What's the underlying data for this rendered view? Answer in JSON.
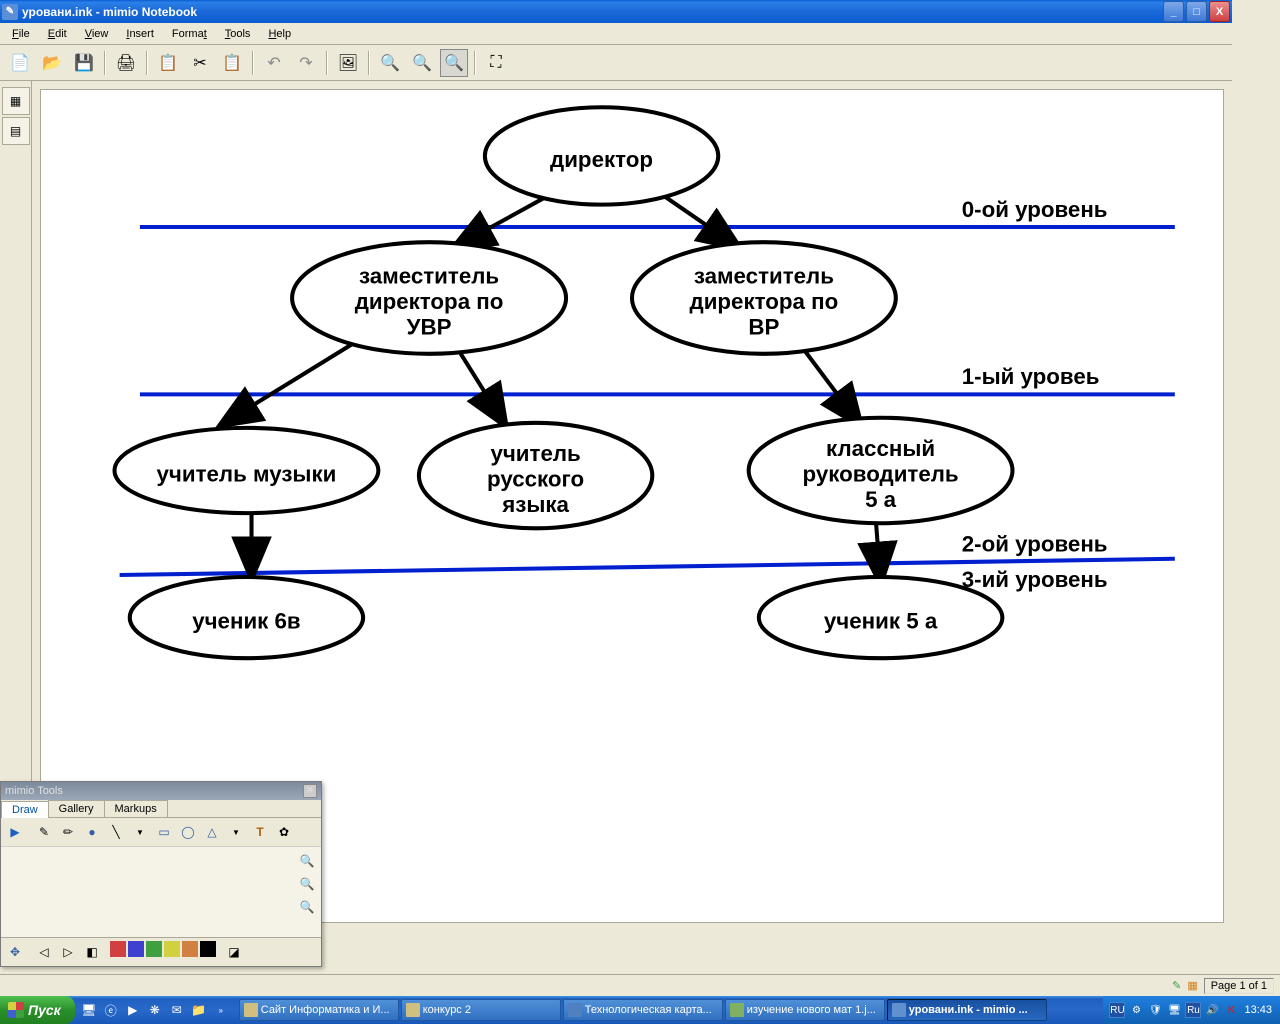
{
  "window": {
    "title": "уровани.ink - mimio Notebook",
    "buttons": {
      "min": "_",
      "max": "□",
      "close": "X"
    }
  },
  "menu": [
    "File",
    "Edit",
    "View",
    "Insert",
    "Format",
    "Tools",
    "Help"
  ],
  "toolbar_icons": [
    "new-file",
    "open-file",
    "save",
    "print",
    "sep",
    "copy",
    "cut",
    "paste",
    "sep",
    "undo",
    "redo",
    "sep",
    "insert-image",
    "sep",
    "zoom-in",
    "zoom-out",
    "zoom-fit",
    "sep",
    "fullscreen"
  ],
  "side_icons": [
    "page-thumb-icon",
    "page-thumb-2-icon"
  ],
  "diagram": {
    "nodes": {
      "director": "директор",
      "deputy_uvr": [
        "заместитель",
        "директора по",
        "УВР"
      ],
      "deputy_vr": [
        "заместитель",
        "директора по",
        "ВР"
      ],
      "music": "учитель музыки",
      "russian": [
        "учитель",
        "русского",
        "языка"
      ],
      "class5a": [
        "классный",
        "руководитель",
        "5 а"
      ],
      "student6v": "ученик 6в",
      "student5a": "ученик 5 а"
    },
    "levels": {
      "l0": "0-ой уровень",
      "l1": "1-ый уровеь",
      "l2": "2-ой уровень",
      "l3": "3-ий уровень"
    }
  },
  "tools_window": {
    "title": "mimio Tools",
    "tabs": [
      "Draw",
      "Gallery",
      "Markups"
    ],
    "top_tools": [
      "pointer",
      "pen",
      "highlighter",
      "circle-fill",
      "line",
      "dropdown",
      "rect",
      "ellipse",
      "triangle",
      "dropdown2",
      "text",
      "stamp"
    ],
    "side_tools": [
      "zoom-in",
      "zoom-out",
      "zoom-fit"
    ],
    "bottom_tools": [
      "move",
      "sep",
      "prev",
      "next",
      "eraser",
      "sep",
      "c1",
      "c2",
      "c3",
      "c4",
      "c5",
      "c6",
      "sep",
      "reveal"
    ]
  },
  "status": {
    "icons": [
      "edit-icon",
      "nav-icon"
    ],
    "page": "Page 1 of 1"
  },
  "taskbar": {
    "start": "Пуск",
    "quicklaunch": [
      "desktop",
      "ie",
      "media",
      "msn",
      "outlook",
      "folder"
    ],
    "tasks": [
      {
        "label": "Сайт Информатика и И...",
        "active": false
      },
      {
        "label": "конкурс 2",
        "active": false
      },
      {
        "label": "Технологическая карта...",
        "active": false
      },
      {
        "label": "изучение нового мат 1.j...",
        "active": false
      },
      {
        "label": "уровани.ink - mimio ...",
        "active": true
      }
    ],
    "tray": {
      "lang": "RU",
      "lang2": "Ru",
      "clock": "13:43"
    }
  }
}
